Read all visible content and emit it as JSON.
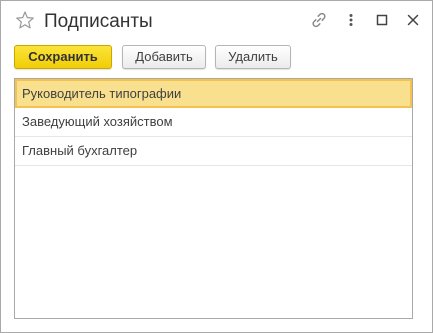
{
  "window": {
    "title": "Подписанты"
  },
  "titlebar_icons": [
    "star-icon",
    "link-icon",
    "more-vertical-icon",
    "maximize-icon",
    "close-icon"
  ],
  "toolbar": {
    "save_label": "Сохранить",
    "add_label": "Добавить",
    "delete_label": "Удалить"
  },
  "list": {
    "items": [
      {
        "label": "Руководитель типографии",
        "selected": true
      },
      {
        "label": "Заведующий хозяйством",
        "selected": false
      },
      {
        "label": "Главный бухгалтер",
        "selected": false
      }
    ]
  },
  "colors": {
    "accent_button": "#f5d30f",
    "selected_row_bg": "#f9e08f",
    "selected_row_border": "#f3c24f"
  }
}
